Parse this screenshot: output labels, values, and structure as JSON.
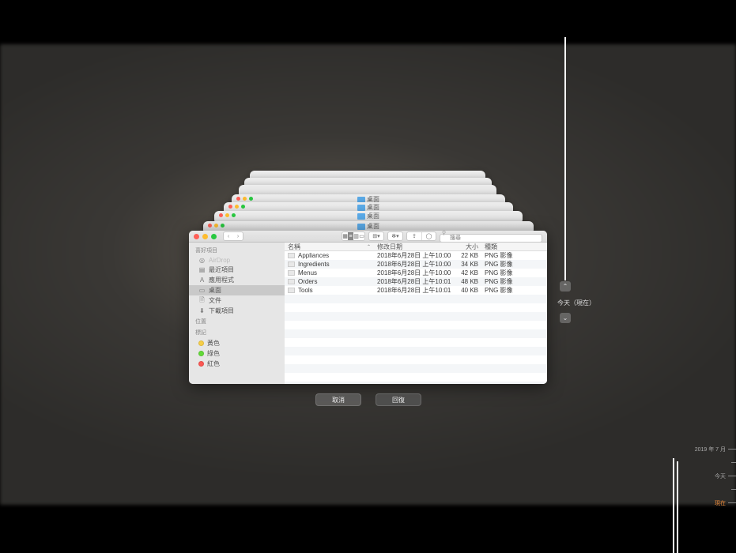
{
  "window": {
    "title": "桌面",
    "search_placeholder": "搜尋"
  },
  "sidebar": {
    "sections": [
      {
        "header": "喜好項目",
        "items": [
          {
            "icon": "airdrop",
            "label": "AirDrop",
            "dim": true
          },
          {
            "icon": "recents",
            "label": "最近項目"
          },
          {
            "icon": "apps",
            "label": "應用程式"
          },
          {
            "icon": "desktop",
            "label": "桌面",
            "selected": true
          },
          {
            "icon": "documents",
            "label": "文件"
          },
          {
            "icon": "downloads",
            "label": "下載項目"
          }
        ]
      },
      {
        "header": "位置",
        "items": []
      },
      {
        "header": "標記",
        "items": [
          {
            "tag": "yellow",
            "label": "黃色"
          },
          {
            "tag": "green",
            "label": "綠色"
          },
          {
            "tag": "red",
            "label": "紅色"
          }
        ]
      }
    ]
  },
  "columns": {
    "name": "名稱",
    "date": "修改日期",
    "size": "大小",
    "kind": "種類"
  },
  "files": [
    {
      "name": "Appliances",
      "date": "2018年6月28日 上午10:00",
      "size": "22 KB",
      "kind": "PNG 影像"
    },
    {
      "name": "Ingredients",
      "date": "2018年6月28日 上午10:00",
      "size": "34 KB",
      "kind": "PNG 影像"
    },
    {
      "name": "Menus",
      "date": "2018年6月28日 上午10:00",
      "size": "42 KB",
      "kind": "PNG 影像"
    },
    {
      "name": "Orders",
      "date": "2018年6月28日 上午10:01",
      "size": "48 KB",
      "kind": "PNG 影像"
    },
    {
      "name": "Tools",
      "date": "2018年6月28日 上午10:01",
      "size": "40 KB",
      "kind": "PNG 影像"
    }
  ],
  "buttons": {
    "cancel": "取消",
    "restore": "回復"
  },
  "timeline_nav": {
    "current": "今天（現在）"
  },
  "timeline": {
    "labels": [
      {
        "text": "2019 年 7 月",
        "now": false
      },
      {
        "text": "",
        "now": false
      },
      {
        "text": "今天",
        "now": false
      },
      {
        "text": "",
        "now": false
      },
      {
        "text": "現在",
        "now": true
      }
    ]
  }
}
